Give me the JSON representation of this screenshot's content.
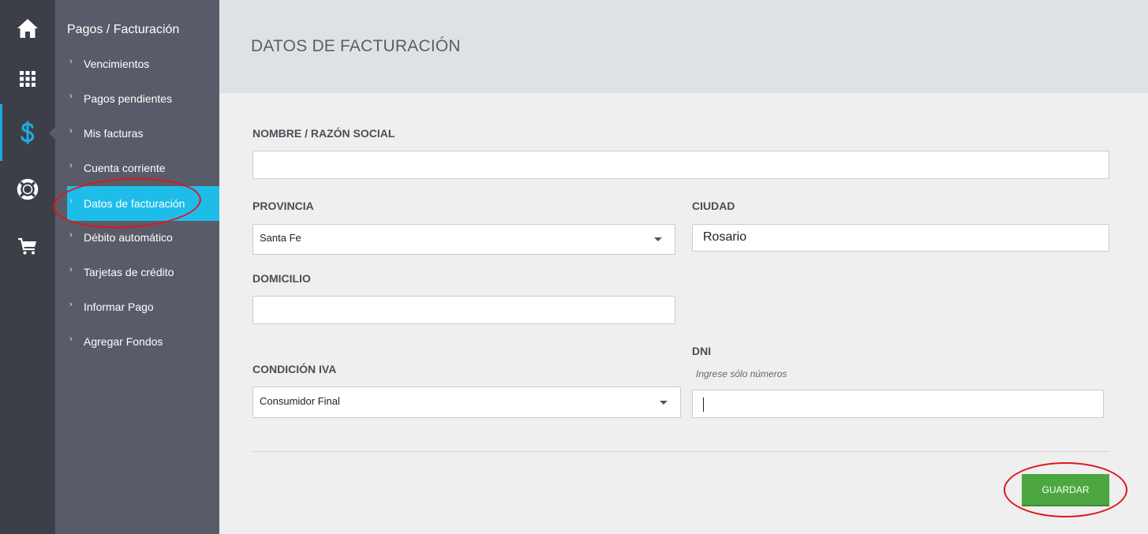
{
  "rail": {
    "icons": [
      "home-icon",
      "grid-icon",
      "dollar-icon",
      "lifebuoy-icon",
      "cart-icon"
    ],
    "active_color": "#21a9e1"
  },
  "submenu": {
    "title": "Pagos / Facturación",
    "items": [
      {
        "label": "Vencimientos"
      },
      {
        "label": "Pagos pendientes"
      },
      {
        "label": "Mis facturas"
      },
      {
        "label": "Cuenta corriente"
      },
      {
        "label": "Datos de facturación",
        "active": true
      },
      {
        "label": "Débito automático"
      },
      {
        "label": "Tarjetas de crédito"
      },
      {
        "label": "Informar Pago"
      },
      {
        "label": "Agregar Fondos"
      }
    ],
    "chevron": "›"
  },
  "header": {
    "title": "DATOS DE FACTURACIÓN"
  },
  "form": {
    "nombre": {
      "label": "NOMBRE / RAZÓN SOCIAL",
      "value": ""
    },
    "provincia": {
      "label": "PROVINCIA",
      "value": "Santa Fe"
    },
    "ciudad": {
      "label": "CIUDAD",
      "value": "Rosario"
    },
    "domicilio": {
      "label": "DOMICILIO",
      "value": ""
    },
    "condicion_iva": {
      "label": "CONDICIÓN IVA",
      "value": "Consumidor Final"
    },
    "dni": {
      "label": "DNI",
      "hint": "Ingrese sólo números",
      "value": ""
    },
    "save_label": "GUARDAR"
  },
  "colors": {
    "accent": "#1ebde9",
    "save_button": "#4ca741",
    "annotation": "#e0141e"
  }
}
